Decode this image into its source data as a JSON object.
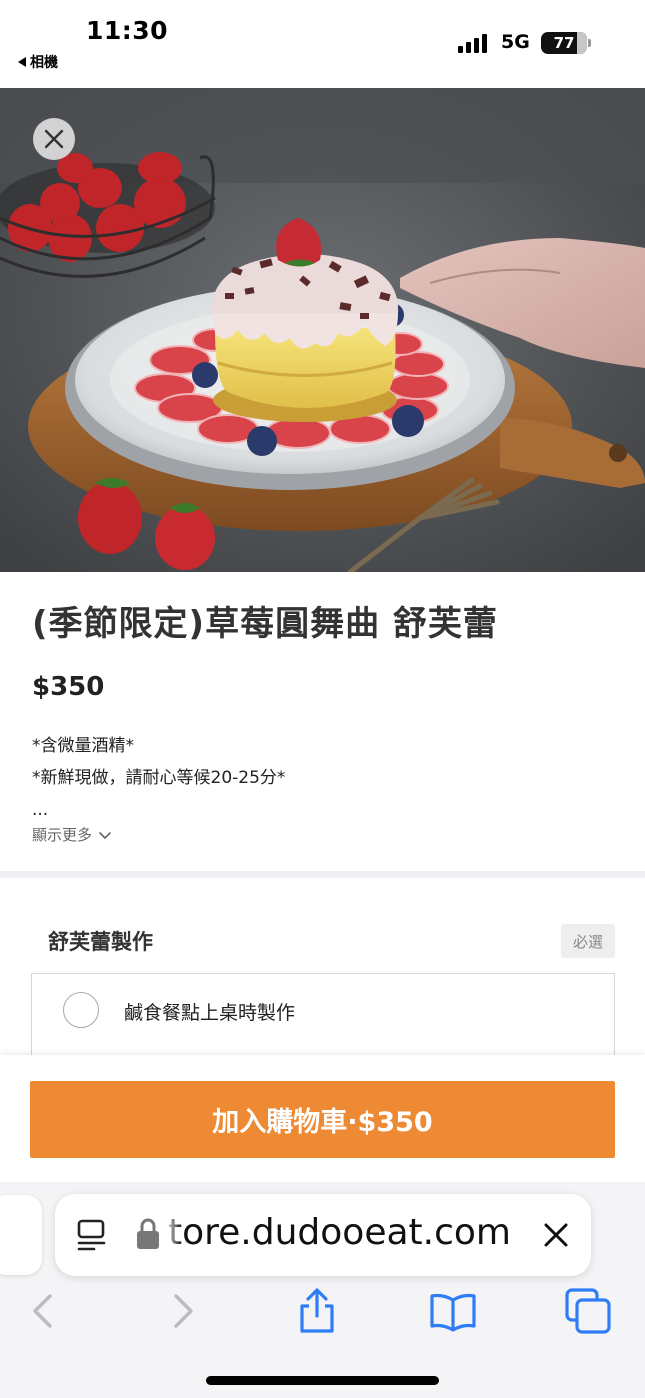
{
  "status_bar": {
    "time": "11:30",
    "back_label": "相機",
    "network": "5G",
    "battery": "77"
  },
  "hero": {
    "image": "strawberry-souffle-pancake-photo"
  },
  "product": {
    "title": "(季節限定)草莓圓舞曲 舒芙蕾",
    "price": "$350",
    "description_lines": [
      "*含微量酒精*",
      "*新鮮現做，請耐心等候20-25分*",
      "..."
    ],
    "show_more_label": "顯示更多"
  },
  "options": {
    "group_title": "舒芙蕾製作",
    "required_label": "必選",
    "items": [
      {
        "label": "鹹食餐點上桌時製作",
        "selected": false
      }
    ]
  },
  "cart": {
    "add_to_cart_label": "加入購物車·$350",
    "accent_color": "#ee8a33"
  },
  "browser": {
    "url": "tore.dudooeat.com",
    "icons": [
      "reader-icon",
      "lock-icon",
      "close-icon",
      "back-icon",
      "forward-icon",
      "share-icon",
      "bookmarks-icon",
      "tabs-icon"
    ]
  }
}
